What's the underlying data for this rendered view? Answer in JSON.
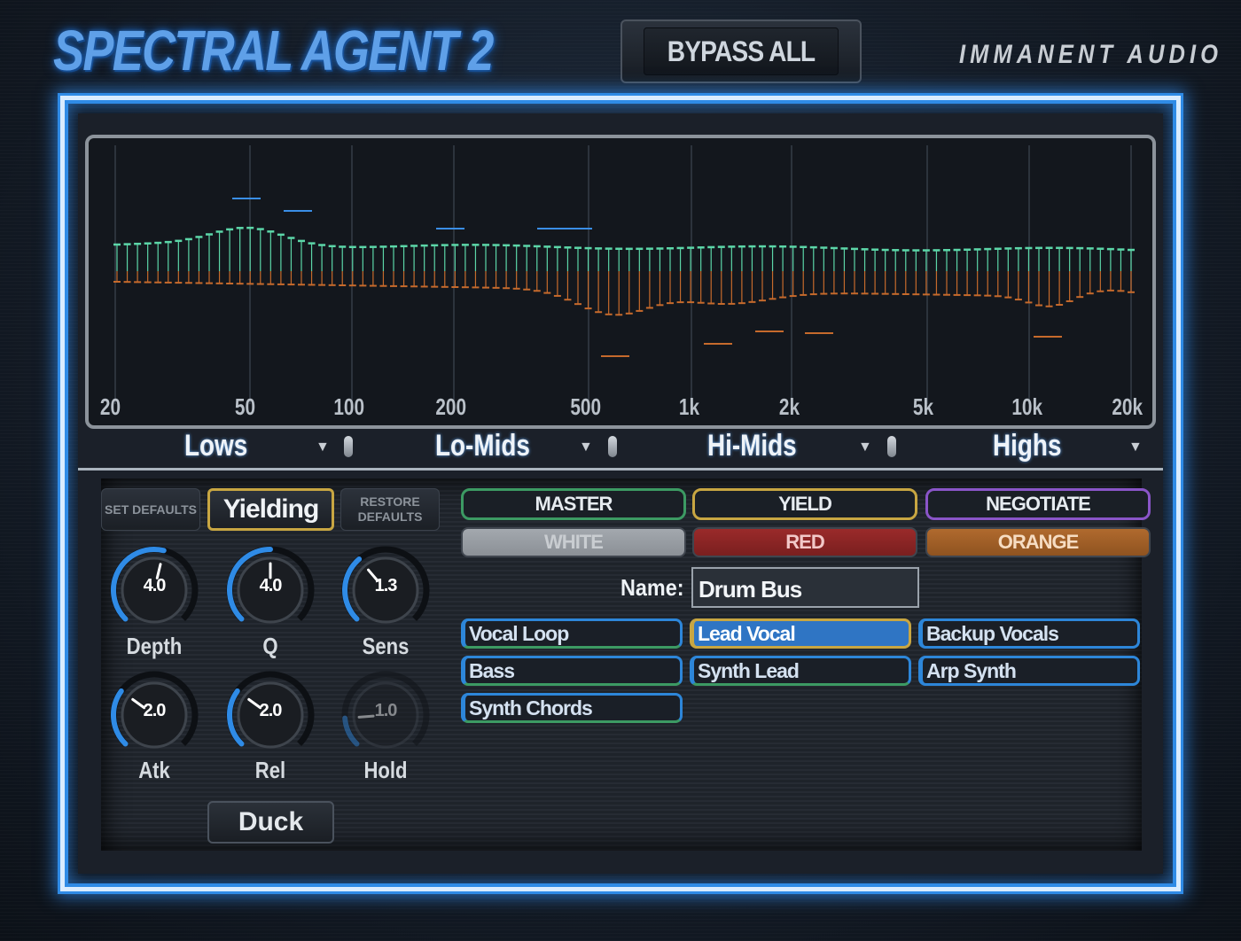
{
  "app": {
    "title": "SPECTRAL AGENT 2",
    "brand": "IMMANENT AUDIO",
    "bypass_label": "BYPASS ALL"
  },
  "graph": {
    "freq_labels": [
      "20",
      "50",
      "100",
      "200",
      "500",
      "1k",
      "2k",
      "5k",
      "10k",
      "20k"
    ],
    "upper_color": "#5cd6a8",
    "lower_color": "#c66a2c",
    "marker_color": "#3a8ee6"
  },
  "bands": {
    "lows": "Lows",
    "lo_mids": "Lo-Mids",
    "hi_mids": "Hi-Mids",
    "highs": "Highs"
  },
  "controls": {
    "set_defaults": "SET DEFAULTS",
    "mode": "Yielding",
    "restore_defaults": "RESTORE DEFAULTS",
    "duck": "Duck",
    "knobs": [
      {
        "label": "Depth",
        "value": "4.0",
        "level": 0.55
      },
      {
        "label": "Q",
        "value": "4.0",
        "level": 0.5
      },
      {
        "label": "Sens",
        "value": "1.3",
        "level": 0.35
      },
      {
        "label": "Atk",
        "value": "2.0",
        "level": 0.3
      },
      {
        "label": "Rel",
        "value": "2.0",
        "level": 0.3
      },
      {
        "label": "Hold",
        "value": "1.0",
        "level": 0.15
      }
    ]
  },
  "roles": {
    "master": "MASTER",
    "yield": "YIELD",
    "negotiate": "NEGOTIATE"
  },
  "colors": {
    "white": "WHITE",
    "red": "RED",
    "orange": "ORANGE"
  },
  "name": {
    "label": "Name:",
    "value": "Drum Bus"
  },
  "tracks": [
    "Vocal Loop",
    "Lead Vocal",
    "Backup Vocals",
    "Bass",
    "Synth Lead",
    "Arp Synth",
    "Synth Chords"
  ]
}
